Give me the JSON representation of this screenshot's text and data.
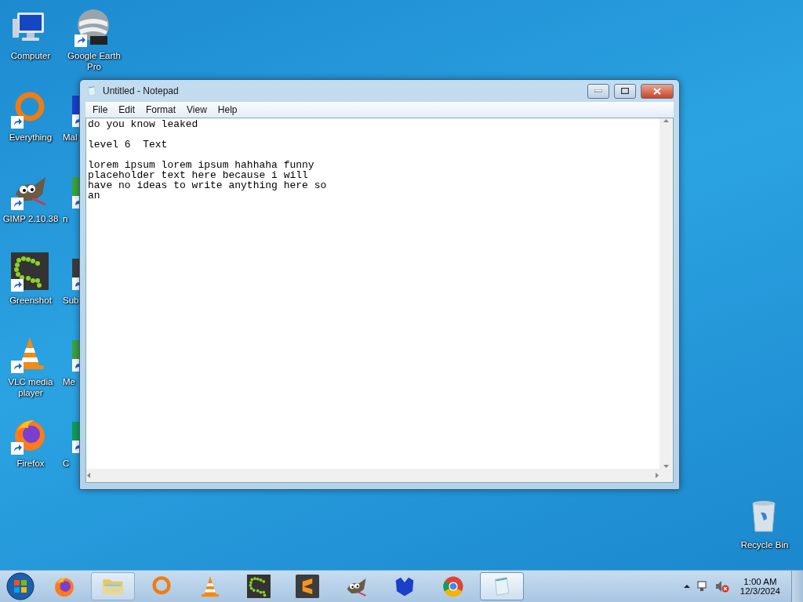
{
  "desktop_icons": [
    {
      "kind": "computer",
      "label": "Computer",
      "shortcut": false
    },
    {
      "kind": "ring",
      "label": "Everything",
      "shortcut": true
    },
    {
      "kind": "gimp",
      "label": "GIMP 2.10.38",
      "shortcut": true
    },
    {
      "kind": "greenshot",
      "label": "Greenshot",
      "shortcut": true
    },
    {
      "kind": "vlc",
      "label": "VLC media player",
      "shortcut": true
    },
    {
      "kind": "firefox",
      "label": "Firefox",
      "shortcut": true
    }
  ],
  "covered_icons": [
    {
      "kind": "earth",
      "label": "Google Earth Pro",
      "shortcut": true,
      "cut": false
    },
    {
      "kind": "shield",
      "label": "Mal",
      "shortcut": true,
      "cut": true
    },
    {
      "kind": "green",
      "label": "n",
      "shortcut": true,
      "cut": true
    },
    {
      "kind": "sublime",
      "label": "Sub",
      "shortcut": true,
      "cut": true
    },
    {
      "kind": "green",
      "label": "Me",
      "shortcut": true,
      "cut": true
    },
    {
      "kind": "chrome",
      "label": "C",
      "shortcut": true,
      "cut": true
    }
  ],
  "recycle_bin": {
    "label": "Recycle Bin"
  },
  "window": {
    "title": "Untitled - Notepad",
    "menu": [
      "File",
      "Edit",
      "Format",
      "View",
      "Help"
    ],
    "paragraphs": [
      [
        "do you know leaked"
      ],
      [
        "level 6  Text"
      ],
      [
        "lorem ipsum lorem ipsum hahhaha funny",
        "placeholder text here because i will",
        "have no ideas to write anything here so",
        "an"
      ]
    ]
  },
  "taskbar": {
    "items": [
      {
        "kind": "folder",
        "selected": false,
        "pinned_active": true
      },
      {
        "kind": "ring",
        "selected": false,
        "pinned_active": false
      },
      {
        "kind": "vlc",
        "selected": false,
        "pinned_active": false
      },
      {
        "kind": "greenshot",
        "selected": false,
        "pinned_active": false
      },
      {
        "kind": "sublime",
        "selected": false,
        "pinned_active": false
      },
      {
        "kind": "gimp",
        "selected": false,
        "pinned_active": false
      },
      {
        "kind": "shield",
        "selected": false,
        "pinned_active": false
      },
      {
        "kind": "chrome",
        "selected": false,
        "pinned_active": false
      },
      {
        "kind": "notepad",
        "selected": true,
        "pinned_active": true
      }
    ],
    "firefox": true,
    "muted": true,
    "time": "1:00 AM",
    "date": "12/3/2024"
  }
}
